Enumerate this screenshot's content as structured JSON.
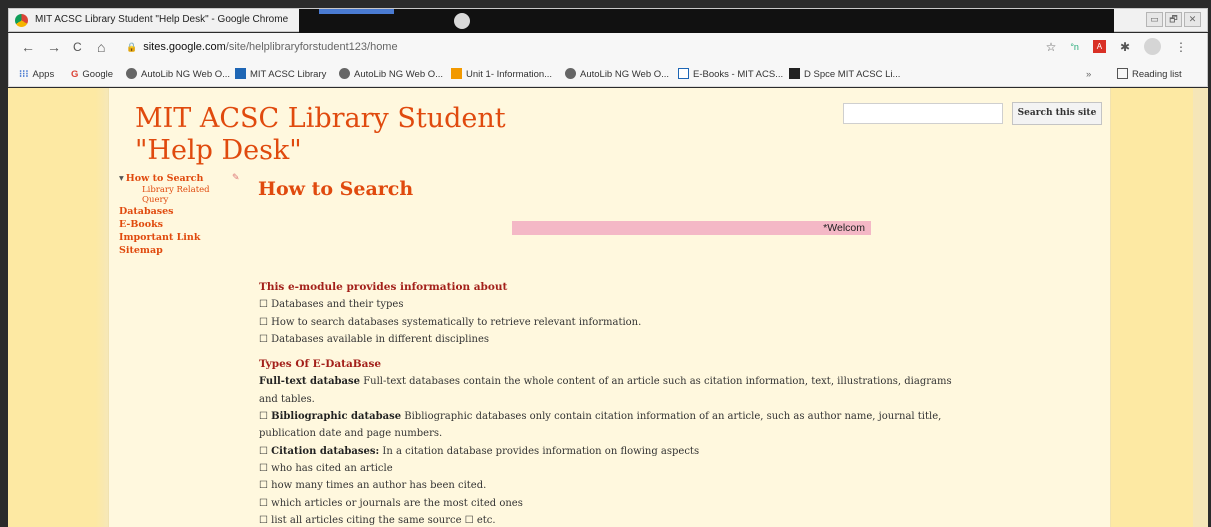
{
  "window": {
    "title": "MIT ACSC Library Student \"Help Desk\" - Google Chrome",
    "controls": [
      "▭",
      "🗗",
      "✕"
    ]
  },
  "toolbar": {
    "back": "←",
    "forward": "→",
    "reload": "C",
    "home": "⌂",
    "lock": "🔒",
    "url_host": "sites.google.com",
    "url_path": "/site/helplibraryforstudent123/home",
    "star": "☆",
    "ext1": "°n",
    "pdf_ext": "A",
    "puzzle": "✱",
    "menu": "⋮"
  },
  "bookmarks": {
    "apps": "Apps",
    "items": [
      {
        "icon": "google-icon",
        "label": "Google"
      },
      {
        "icon": "globe-icon",
        "label": "AutoLib NG Web O..."
      },
      {
        "icon": "library-icon",
        "label": "MIT ACSC Library"
      },
      {
        "icon": "globe-icon",
        "label": "AutoLib NG Web O..."
      },
      {
        "icon": "unit-icon",
        "label": "Unit 1- Information..."
      },
      {
        "icon": "globe-icon",
        "label": "AutoLib NG Web O..."
      },
      {
        "icon": "ebook-icon",
        "label": "E-Books - MIT ACS..."
      },
      {
        "icon": "dspace-icon",
        "label": "D Spce MIT ACSC Li..."
      }
    ],
    "overflow": "»",
    "reading_list": "Reading list"
  },
  "site": {
    "title_line1": "MIT ACSC Library Student",
    "title_line2": "\"Help Desk\"",
    "search_button": "Search this site",
    "search_value": ""
  },
  "nav": {
    "caret": "▾",
    "active": "How to Search",
    "edit_icon": "✎",
    "sub_line1": "Library Related",
    "sub_line2": "Query",
    "items": [
      "Databases",
      "E-Books",
      "Important Link",
      "Sitemap"
    ]
  },
  "main": {
    "heading": "How to Search",
    "marquee": "*Welcom",
    "section1_heading": "This e-module provides information about",
    "section1_items": [
      "☐ Databases and their types",
      "☐ How to search databases systematically to retrieve relevant information.",
      "☐ Databases available in different disciplines"
    ],
    "section2_heading": "Types Of E-DataBase",
    "fulltext_term": "Full-text database",
    "fulltext_desc": " Full-text databases contain the whole content of an article such as citation information, text, illustrations, diagrams",
    "fulltext_desc2": "and tables.",
    "biblio_box": "☐ ",
    "biblio_term": "Bibliographic database",
    "biblio_desc": " Bibliographic databases only contain citation information of an article, such as author name, journal title,",
    "biblio_desc2": "publication date and page numbers.",
    "citation_box": "☐ ",
    "citation_term": "Citation databases:",
    "citation_desc": " In a citation database provides information on flowing aspects",
    "citation_items": [
      "☐ who has cited an article",
      "☐ how many times an author has been cited.",
      "☐ which articles or journals are the most cited ones",
      "☐ list all articles citing the same source ☐ etc."
    ]
  }
}
